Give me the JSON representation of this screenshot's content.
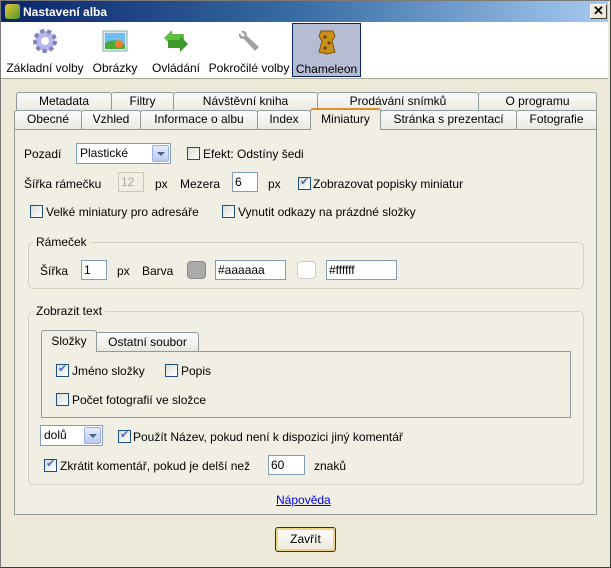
{
  "window": {
    "title": "Nastavení alba",
    "close": "✕"
  },
  "toolbar": {
    "items": [
      {
        "label": "Základní volby",
        "icon": "gear-icon"
      },
      {
        "label": "Obrázky",
        "icon": "image-icon"
      },
      {
        "label": "Ovládání",
        "icon": "arrows-icon"
      },
      {
        "label": "Pokročilé volby",
        "icon": "wrench-icon"
      },
      {
        "label": "Chameleon",
        "icon": "chameleon-skin-icon",
        "selected": true
      }
    ]
  },
  "tabs": {
    "row1": [
      "Metadata",
      "Filtry",
      "Návštěvní kniha",
      "Prodávání snímků",
      "O programu"
    ],
    "row2": [
      "Obecné",
      "Vzhled",
      "Informace o albu",
      "Index",
      "Miniatury",
      "Stránka s prezentací",
      "Fotografie"
    ],
    "selected": "Miniatury"
  },
  "miniatury": {
    "background_label": "Pozadí",
    "background_value": "Plastické",
    "effect_label": "Efekt: Odstíny šedi",
    "effect_checked": false,
    "frame_width_label": "Šířka rámečku",
    "frame_width_value": "12",
    "px": "px",
    "gap_label": "Mezera",
    "gap_value": "6",
    "show_captions_label": "Zobrazovat popisky miniatur",
    "show_captions_checked": true,
    "large_thumbs_label": "Velké miniatury pro adresáře",
    "large_thumbs_checked": false,
    "force_links_label": "Vynutit odkazy na prázdné složky",
    "force_links_checked": false,
    "frame_group": {
      "title": "Rámeček",
      "width_label": "Šířka",
      "width_value": "1",
      "color_label": "Barva",
      "color1": "#aaaaaa",
      "color2": "#ffffff",
      "color1_text": "#aaaaaa",
      "color2_text": "#ffffff"
    },
    "text_group": {
      "title": "Zobrazit text",
      "tabs": [
        "Složky",
        "Ostatní soubor"
      ],
      "folder_name_label": "Jméno složky",
      "folder_name_checked": true,
      "description_label": "Popis",
      "description_checked": false,
      "photo_count_label": "Počet fotografií ve složce",
      "photo_count_checked": false,
      "position_value": "dolů",
      "use_title_label": "Použít Název, pokud není k dispozici jiný komentář",
      "use_title_checked": true,
      "shorten_label": "Zkrátit komentář, pokud je delší než",
      "shorten_checked": true,
      "shorten_value": "60",
      "chars_label": "znaků"
    },
    "help_link": "Nápověda"
  },
  "footer": {
    "close_button": "Zavřít"
  }
}
